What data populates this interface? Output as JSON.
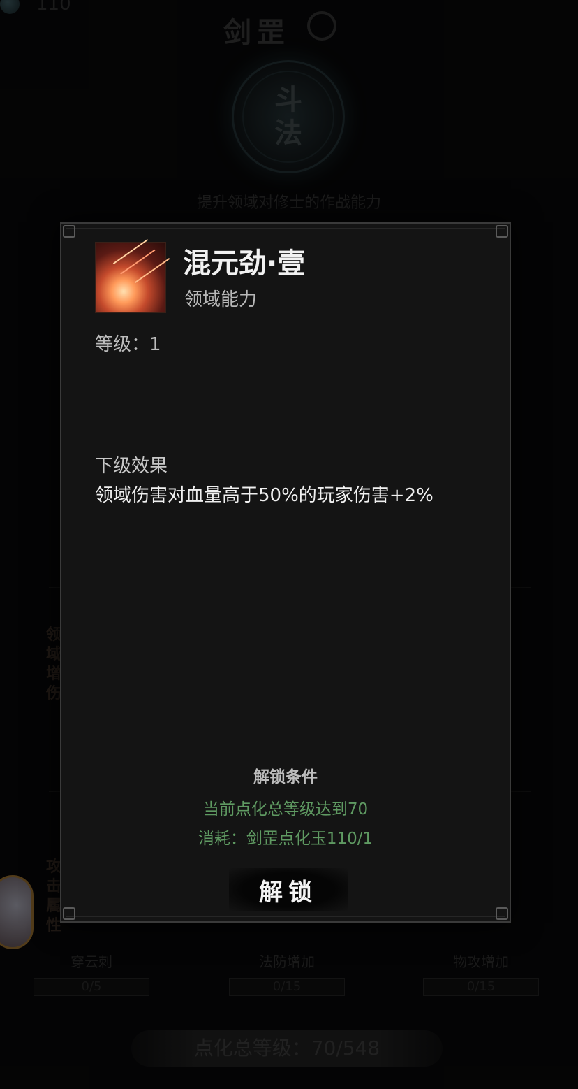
{
  "background": {
    "counter": "110",
    "title": "剑罡",
    "emblem": [
      "斗",
      "法"
    ],
    "subtitle": "提升领域对修士的作战能力",
    "side_tab_1": [
      "领",
      "域",
      "增",
      "伤"
    ],
    "side_tab_2": [
      "攻",
      "击",
      "属",
      "性"
    ],
    "nodes": [
      {
        "label": "穿云刺",
        "progress": "0/5"
      },
      {
        "label": "法防增加",
        "progress": "0/15"
      },
      {
        "label": "物攻增加",
        "progress": "0/15"
      }
    ],
    "total_level": "点化总等级：70/548"
  },
  "modal": {
    "skill_name": "混元劲·壹",
    "skill_type": "领域能力",
    "level_label": "等级：",
    "level_value": "1",
    "next_effect_title": "下级效果",
    "next_effect_text": "领域伤害对血量高于50%的玩家伤害+2%",
    "unlock_title": "解锁条件",
    "condition_1": "当前点化总等级达到70",
    "condition_2": "消耗：剑罡点化玉110/1",
    "unlock_button": "解锁"
  },
  "colors": {
    "condition_green": "#5f9a62",
    "modal_bg": "#141414"
  }
}
